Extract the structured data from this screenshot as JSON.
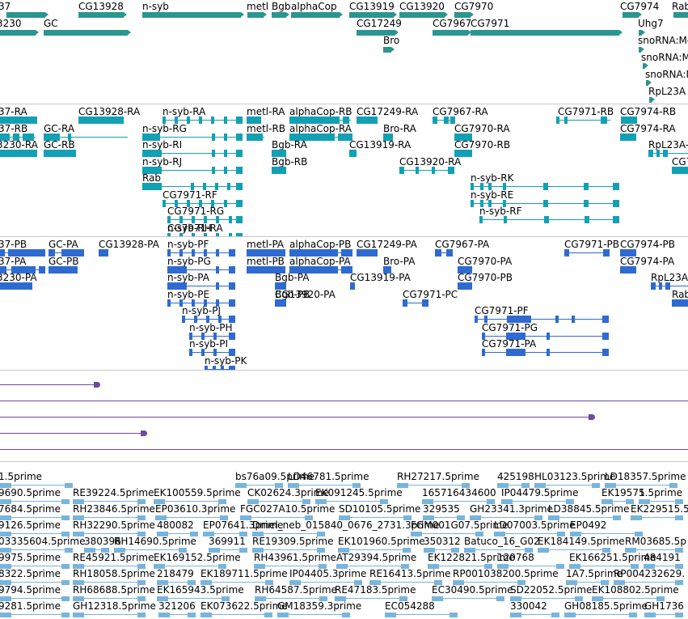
{
  "genes": {
    "labels": [
      "37",
      "CG13928",
      "n-syb",
      "metl",
      "Bgb",
      "alphaCop",
      "CG13919",
      "CG13920",
      "CG7970",
      "CG7974",
      "Rab",
      "3230",
      "GC",
      "CG17249",
      "CG7967",
      "CG7971",
      "Uhg7",
      "Bro",
      "snoRNA:Me",
      "snoRNA:M",
      "snoRNA:M",
      "RpL23A"
    ]
  },
  "transcripts": {
    "labels": [
      "37-RA",
      "CG13928-RA",
      "n-syb-RA",
      "metl-RA",
      "alphaCop-RB",
      "CG17249-RA",
      "CG7967-RA",
      "CG7971-RB",
      "CG7974-RB",
      "37-RB",
      "GC-RA",
      "n-syb-RG",
      "metl-RB",
      "alphaCop-RA",
      "Bro-RA",
      "CG7970-RA",
      "CG7974-RA",
      "3230-RA",
      "GC-RB",
      "n-syb-RI",
      "Bgb-RA",
      "CG13919-RA",
      "CG7970-RB",
      "RpL23A-",
      "n-syb-RJ",
      "Bgb-RB",
      "CG13920-RA",
      "CG7971-RC",
      "Rab",
      "n-syb-RK",
      "CG7971-RF",
      "n-syb-RE",
      "CG7971-RG",
      "n-syb-RF",
      "CG7971-RA",
      "n-syb-RH"
    ]
  },
  "proteins": {
    "labels": [
      "37-PB",
      "GC-PA",
      "CG13928-PA",
      "n-syb-PF",
      "metl-PA",
      "alphaCop-PB",
      "CG17249-PA",
      "CG7967-PA",
      "CG7971-PB",
      "CG7974-PB",
      "37-PA",
      "GC-PB",
      "n-syb-PG",
      "metl-PB",
      "alphaCop-PA",
      "Bro-PA",
      "CG7970-PA",
      "CG7974-PA",
      "3230-PA",
      "n-syb-PA",
      "Bgb-PA",
      "CG13919-PA",
      "CG7970-PB",
      "RpL23A",
      "n-syb-PE",
      "CG13920-PA",
      "CG7971-PC",
      "Rab",
      "n-syb-PJ",
      "Bgb-PB",
      "CG7971-PF",
      "n-syb-PH",
      "CG7971-PG",
      "n-syb-PI",
      "CG7971-PA",
      "n-syb-PK"
    ]
  },
  "ests": {
    "rows": [
      [
        "1.5prime",
        "bs76a09.5prime",
        "LD46781.5prime",
        "RH27217.5prime",
        "425198",
        "HL03123.5prime",
        "LD18357.5prime"
      ],
      [
        "9690.5prime",
        "RE39224.5prime",
        "EK100559.5prime",
        "CK02624.3prime",
        "EK091245.5prime",
        "165716434600",
        "IP04479.5prime",
        "EK19575",
        "1.5prime"
      ],
      [
        "7684.5prime",
        "RH23846.5prime",
        "EP03610.3prime",
        "FGC027A10.5prime",
        "SD10105.5prime",
        "329535",
        "GH23341.3prime",
        "LD38845.5prime",
        "EK229515.5"
      ],
      [
        "9126.5prime",
        "RH32290.5prime",
        "480082",
        "EP07641.3prime",
        "Dmel_neb_015840_0676_2731.3prime",
        "FGM001G07.5prime",
        "LD07003.5prime",
        "EP0492"
      ],
      [
        "03335604.5prime",
        "380396",
        "RH14690.5prime",
        "369911",
        "RE19309.5prime",
        "EK101960.5prime",
        "350312",
        "Batuco_16_G02",
        "EK184149.5prime",
        "RM03685.5p"
      ],
      [
        "9975.5prime",
        "RE45921.5prime",
        "EK169152.5prime",
        "RH43961.5prime",
        "AT29394.5prime",
        "EK122821.5prime",
        "120768",
        "EK166251.5prime",
        "484191"
      ],
      [
        "8322.5prime",
        "RH18058.5prime",
        "218479",
        "EK189711.5prime",
        "IP04405.3prime",
        "RE16413.5prime",
        "RP001038200.5prime",
        "1A7.5prime",
        "RP004232629."
      ],
      [
        "9794.5prime",
        "RH68688.5prime",
        "EK165943.5prime",
        "RH64587.5prime",
        "RE47183.5prime",
        "EC30490.5prime",
        "SD22052.5prime",
        "EK108802.5prime"
      ],
      [
        "9281.5prime",
        "GH12318.5prime",
        "321206",
        "EK073622.5prime",
        "GM18359.3prime",
        "EC054288",
        "330042",
        "GH08185.5prime",
        "GH1736"
      ]
    ]
  },
  "colors": {
    "gene": "#2b9590",
    "transcript": "#13a0b5",
    "protein": "#2f6ad0",
    "purple": "#6b4aa0",
    "est": "#79b4dc"
  }
}
